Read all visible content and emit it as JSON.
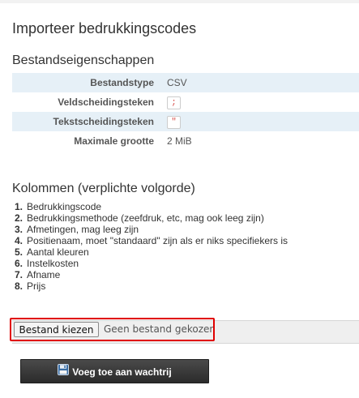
{
  "page": {
    "title": "Importeer bedrukkingscodes"
  },
  "properties": {
    "heading": "Bestandseigenschappen",
    "rows": [
      {
        "label": "Bestandstype",
        "value": "CSV"
      },
      {
        "label": "Veldscheidingsteken",
        "value": ";"
      },
      {
        "label": "Tekstscheidingsteken",
        "value": "\""
      },
      {
        "label": "Maximale grootte",
        "value": "2 MiB"
      }
    ]
  },
  "columns": {
    "heading": "Kolommen (verplichte volgorde)",
    "items": [
      {
        "num": "1.",
        "text": "Bedrukkingscode"
      },
      {
        "num": "2.",
        "text": "Bedrukkingsmethode (zeefdruk, etc, mag ook leeg zijn)"
      },
      {
        "num": "3.",
        "text": "Afmetingen, mag leeg zijn"
      },
      {
        "num": "4.",
        "text": "Positienaam, moet \"standaard\" zijn als er niks specifiekers is"
      },
      {
        "num": "5.",
        "text": "Aantal kleuren"
      },
      {
        "num": "6.",
        "text": "Instelkosten"
      },
      {
        "num": "7.",
        "text": "Afname"
      },
      {
        "num": "8.",
        "text": "Prijs"
      }
    ]
  },
  "upload": {
    "choose_label": "Bestand kiezen",
    "no_file_text": "Geen bestand gekozen"
  },
  "actions": {
    "queue_label": "Voeg toe aan wachtrij",
    "queue_icon": "floppy-disk-icon"
  },
  "colors": {
    "highlight": "#e00000",
    "row_alt": "#e6f0f7",
    "button_dark": "#2b2b2b"
  }
}
